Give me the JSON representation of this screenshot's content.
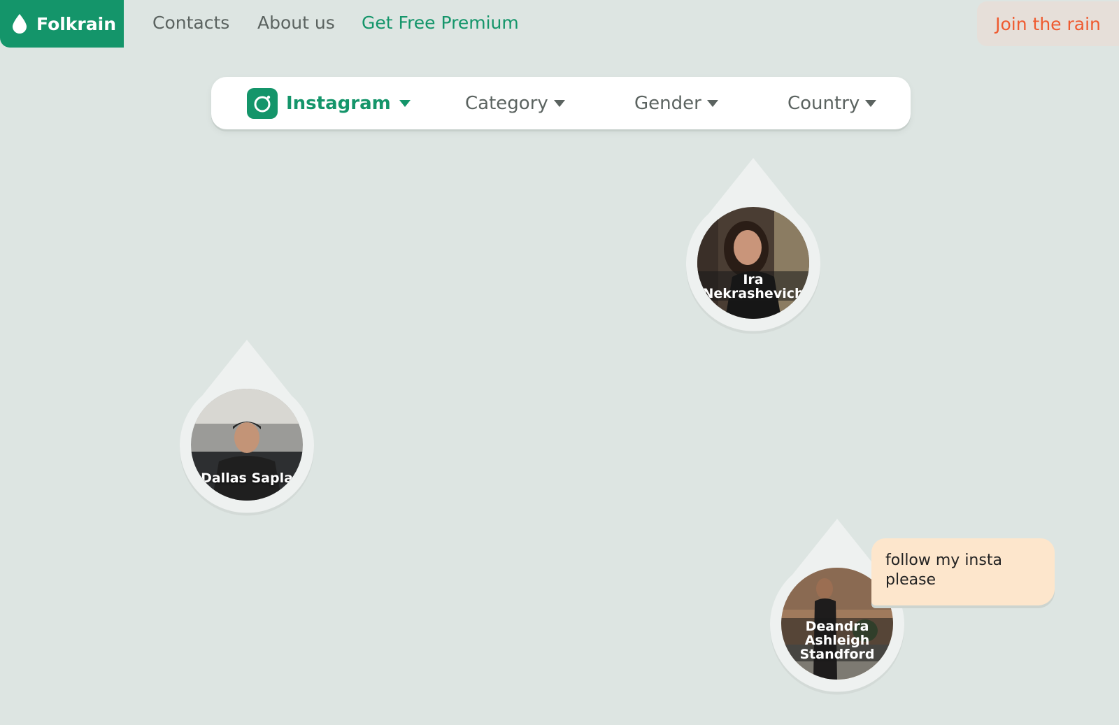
{
  "nav": {
    "logo_label": "Folkrain",
    "links": [
      "Contacts",
      "About us",
      "Get Free Premium"
    ],
    "join_label": "Join the rain"
  },
  "filters": {
    "platform": "Instagram",
    "category": "Category",
    "gender": "Gender",
    "country": "Country"
  },
  "drops": [
    {
      "name": "Ira Nekrashevich"
    },
    {
      "name": "Dallas Sapla"
    },
    {
      "name": "Deandra Ashleigh Standford"
    }
  ],
  "bubble": {
    "text": "follow my insta please"
  },
  "colors": {
    "accent": "#14956a",
    "background": "#dde5e2",
    "join": "#ef5a2f",
    "bubble": "#fde6cc"
  },
  "icons": {
    "logo": "droplet-icon",
    "platform": "instagram-icon",
    "dropdown": "caret-down-icon"
  }
}
